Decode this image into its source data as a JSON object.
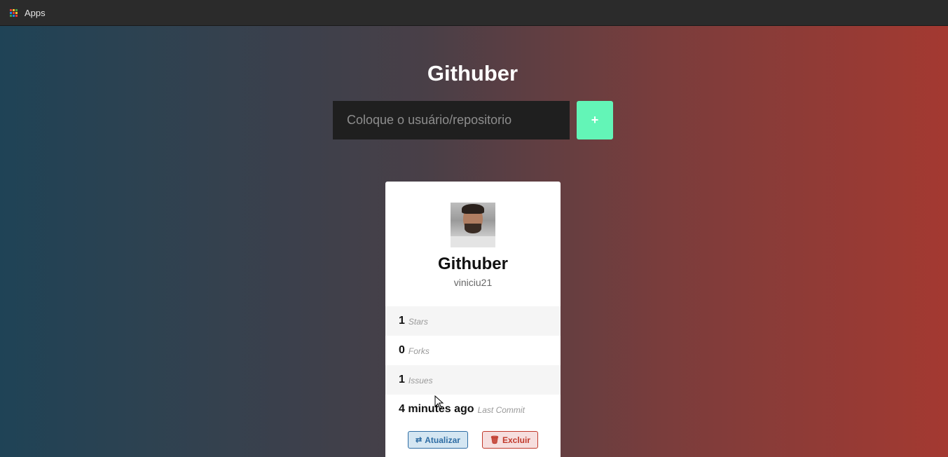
{
  "bookmarks_bar": {
    "apps_label": "Apps",
    "apps_colors": [
      "#e53935",
      "#fbc02d",
      "#43a047",
      "#1e88e5",
      "#e53935",
      "#fbc02d",
      "#43a047",
      "#1e88e5",
      "#e53935"
    ]
  },
  "page": {
    "title": "Githuber",
    "search": {
      "value": "",
      "placeholder": "Coloque o usuário/repositorio"
    },
    "add_label": "+",
    "accent": "#63f5b7"
  },
  "card": {
    "name": "Githuber",
    "owner": "viniciu21",
    "stats": [
      {
        "value": "1",
        "label": "Stars"
      },
      {
        "value": "0",
        "label": "Forks"
      },
      {
        "value": "1",
        "label": "Issues"
      },
      {
        "value": "4 minutes ago",
        "label": "Last Commit"
      }
    ],
    "actions": {
      "update_label": "Atualizar",
      "update_icon": "refresh-icon",
      "delete_label": "Excluir",
      "delete_icon": "trash-icon"
    }
  }
}
